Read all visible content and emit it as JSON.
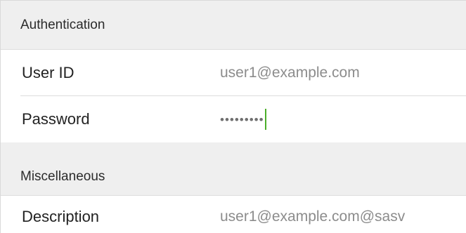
{
  "sections": {
    "authentication": {
      "title": "Authentication",
      "user_id": {
        "label": "User ID",
        "value": "user1@example.com"
      },
      "password": {
        "label": "Password",
        "value": "•••••••••"
      }
    },
    "miscellaneous": {
      "title": "Miscellaneous",
      "description": {
        "label": "Description",
        "value": "user1@example.com@sasv"
      }
    }
  },
  "colors": {
    "section_background": "#efefef",
    "caret": "#4caf2a"
  }
}
